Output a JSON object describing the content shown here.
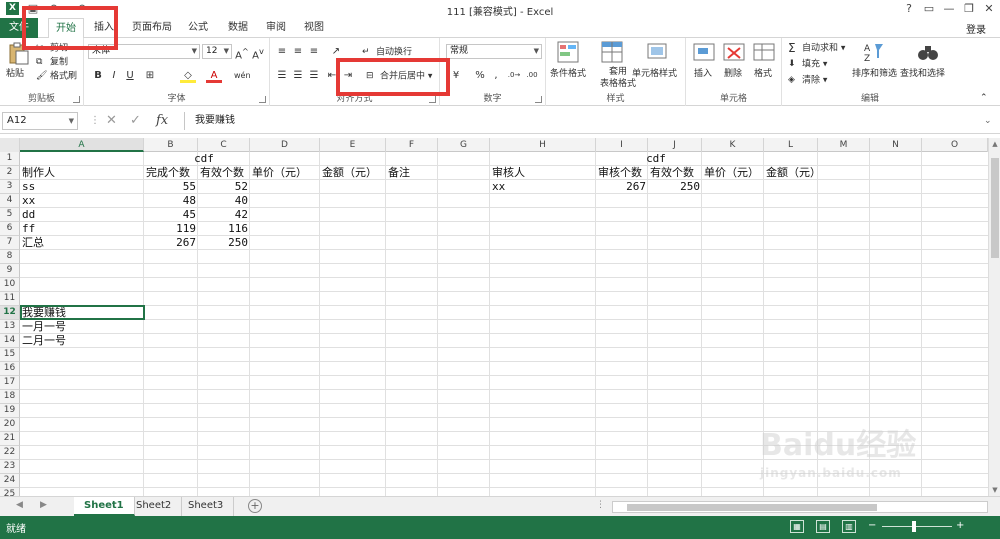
{
  "window": {
    "title": "111  [兼容模式] - Excel",
    "help": "?",
    "min": "—",
    "restore": "❐",
    "close": "✕"
  },
  "ribbon_tabs": [
    "文件",
    "开始",
    "插入",
    "页面布局",
    "公式",
    "数据",
    "审阅",
    "视图"
  ],
  "login": "登录",
  "clipboard": {
    "paste": "粘贴",
    "cut": "剪切",
    "copy": "复制",
    "format_painter": "格式刷",
    "label": "剪贴板"
  },
  "font": {
    "name": "宋体",
    "size": "12",
    "bold": "B",
    "italic": "I",
    "underline": "U",
    "label": "字体"
  },
  "alignment": {
    "wrap": "自动换行",
    "merge": "合并后居中",
    "label": "对齐方式"
  },
  "number": {
    "format": "常规",
    "percent": "%",
    "comma": ",",
    "label": "数字"
  },
  "styles": {
    "conditional": "条件格式",
    "table": "套用\n表格格式",
    "table_line1": "套用",
    "table_line2": "表格格式",
    "cell_style": "单元格样式",
    "label": "样式"
  },
  "cells": {
    "insert": "插入",
    "delete": "删除",
    "format": "格式",
    "label": "单元格"
  },
  "editing": {
    "autosum": "自动求和",
    "fill": "填充",
    "clear": "清除",
    "sort": "排序和筛选",
    "find": "查找和选择",
    "label": "编辑"
  },
  "formula_bar": {
    "name_box": "A12",
    "fx": "fx",
    "content": "我要赚钱"
  },
  "columns": [
    "A",
    "B",
    "C",
    "D",
    "E",
    "F",
    "G",
    "H",
    "I",
    "J",
    "K",
    "L",
    "M",
    "N",
    "O"
  ],
  "rows": [
    "1",
    "2",
    "3",
    "4",
    "5",
    "6",
    "7",
    "8",
    "9",
    "10",
    "11",
    "12",
    "13",
    "14",
    "15",
    "16",
    "17",
    "18",
    "19",
    "20",
    "21",
    "22",
    "23",
    "24",
    "25"
  ],
  "sheet": {
    "left_title": "cdf",
    "right_title": "cdf",
    "header_left": [
      "制作人",
      "完成个数",
      "有效个数",
      "单价（元）",
      "金额（元）",
      "备注"
    ],
    "header_right": [
      "审核人",
      "审核个数",
      "有效个数",
      "单价（元）",
      "金额（元）"
    ],
    "data_left": [
      [
        "ss",
        "55",
        "52"
      ],
      [
        "xx",
        "48",
        "40"
      ],
      [
        "dd",
        "45",
        "42"
      ],
      [
        "ff",
        "119",
        "116"
      ],
      [
        "汇总",
        "267",
        "250"
      ]
    ],
    "data_right": [
      [
        "xx",
        "267",
        "250"
      ]
    ],
    "notes": [
      "我要赚钱",
      "一月一号",
      "二月一号"
    ]
  },
  "sheet_tabs": [
    "Sheet1",
    "Sheet2",
    "Sheet3"
  ],
  "status": "就绪",
  "watermark": "Baidu经验",
  "watermark_sub": "jingyan.baidu.com",
  "colors": {
    "excel_green": "#217346",
    "highlight_red": "#e53935"
  }
}
